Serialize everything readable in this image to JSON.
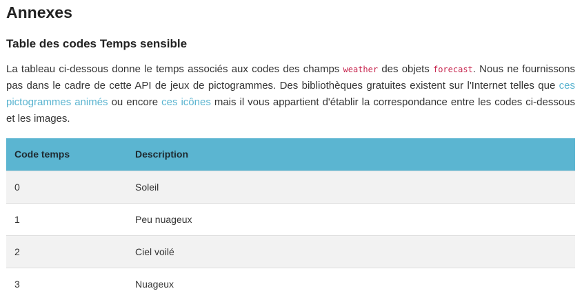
{
  "page": {
    "title": "Annexes",
    "section_title": "Table des codes Temps sensible"
  },
  "intro": {
    "t1": "La tableau ci-dessous donne le temps associés aux codes des champs ",
    "code1": "weather",
    "t2": " des objets ",
    "code2": "forecast",
    "t3": ". Nous ne fournissons pas dans le cadre de cette API de jeux de pictogrammes. Des bibliothèques gratuites existent sur l'Internet telles que ",
    "link1": "ces pictogrammes animés",
    "t4": " ou encore ",
    "link2": "ces icônes",
    "t5": " mais il vous appartient d'établir la correspondance entre les codes ci-dessous et les images."
  },
  "table": {
    "headers": [
      "Code temps",
      "Description"
    ],
    "rows": [
      {
        "code": "0",
        "description": "Soleil"
      },
      {
        "code": "1",
        "description": "Peu nuageux"
      },
      {
        "code": "2",
        "description": "Ciel voilé"
      },
      {
        "code": "3",
        "description": "Nuageux"
      }
    ]
  },
  "colors": {
    "header_bg": "#5bb5d1",
    "link": "#5ab4d0",
    "code": "#c7254e",
    "row_alt": "#f2f2f2"
  }
}
